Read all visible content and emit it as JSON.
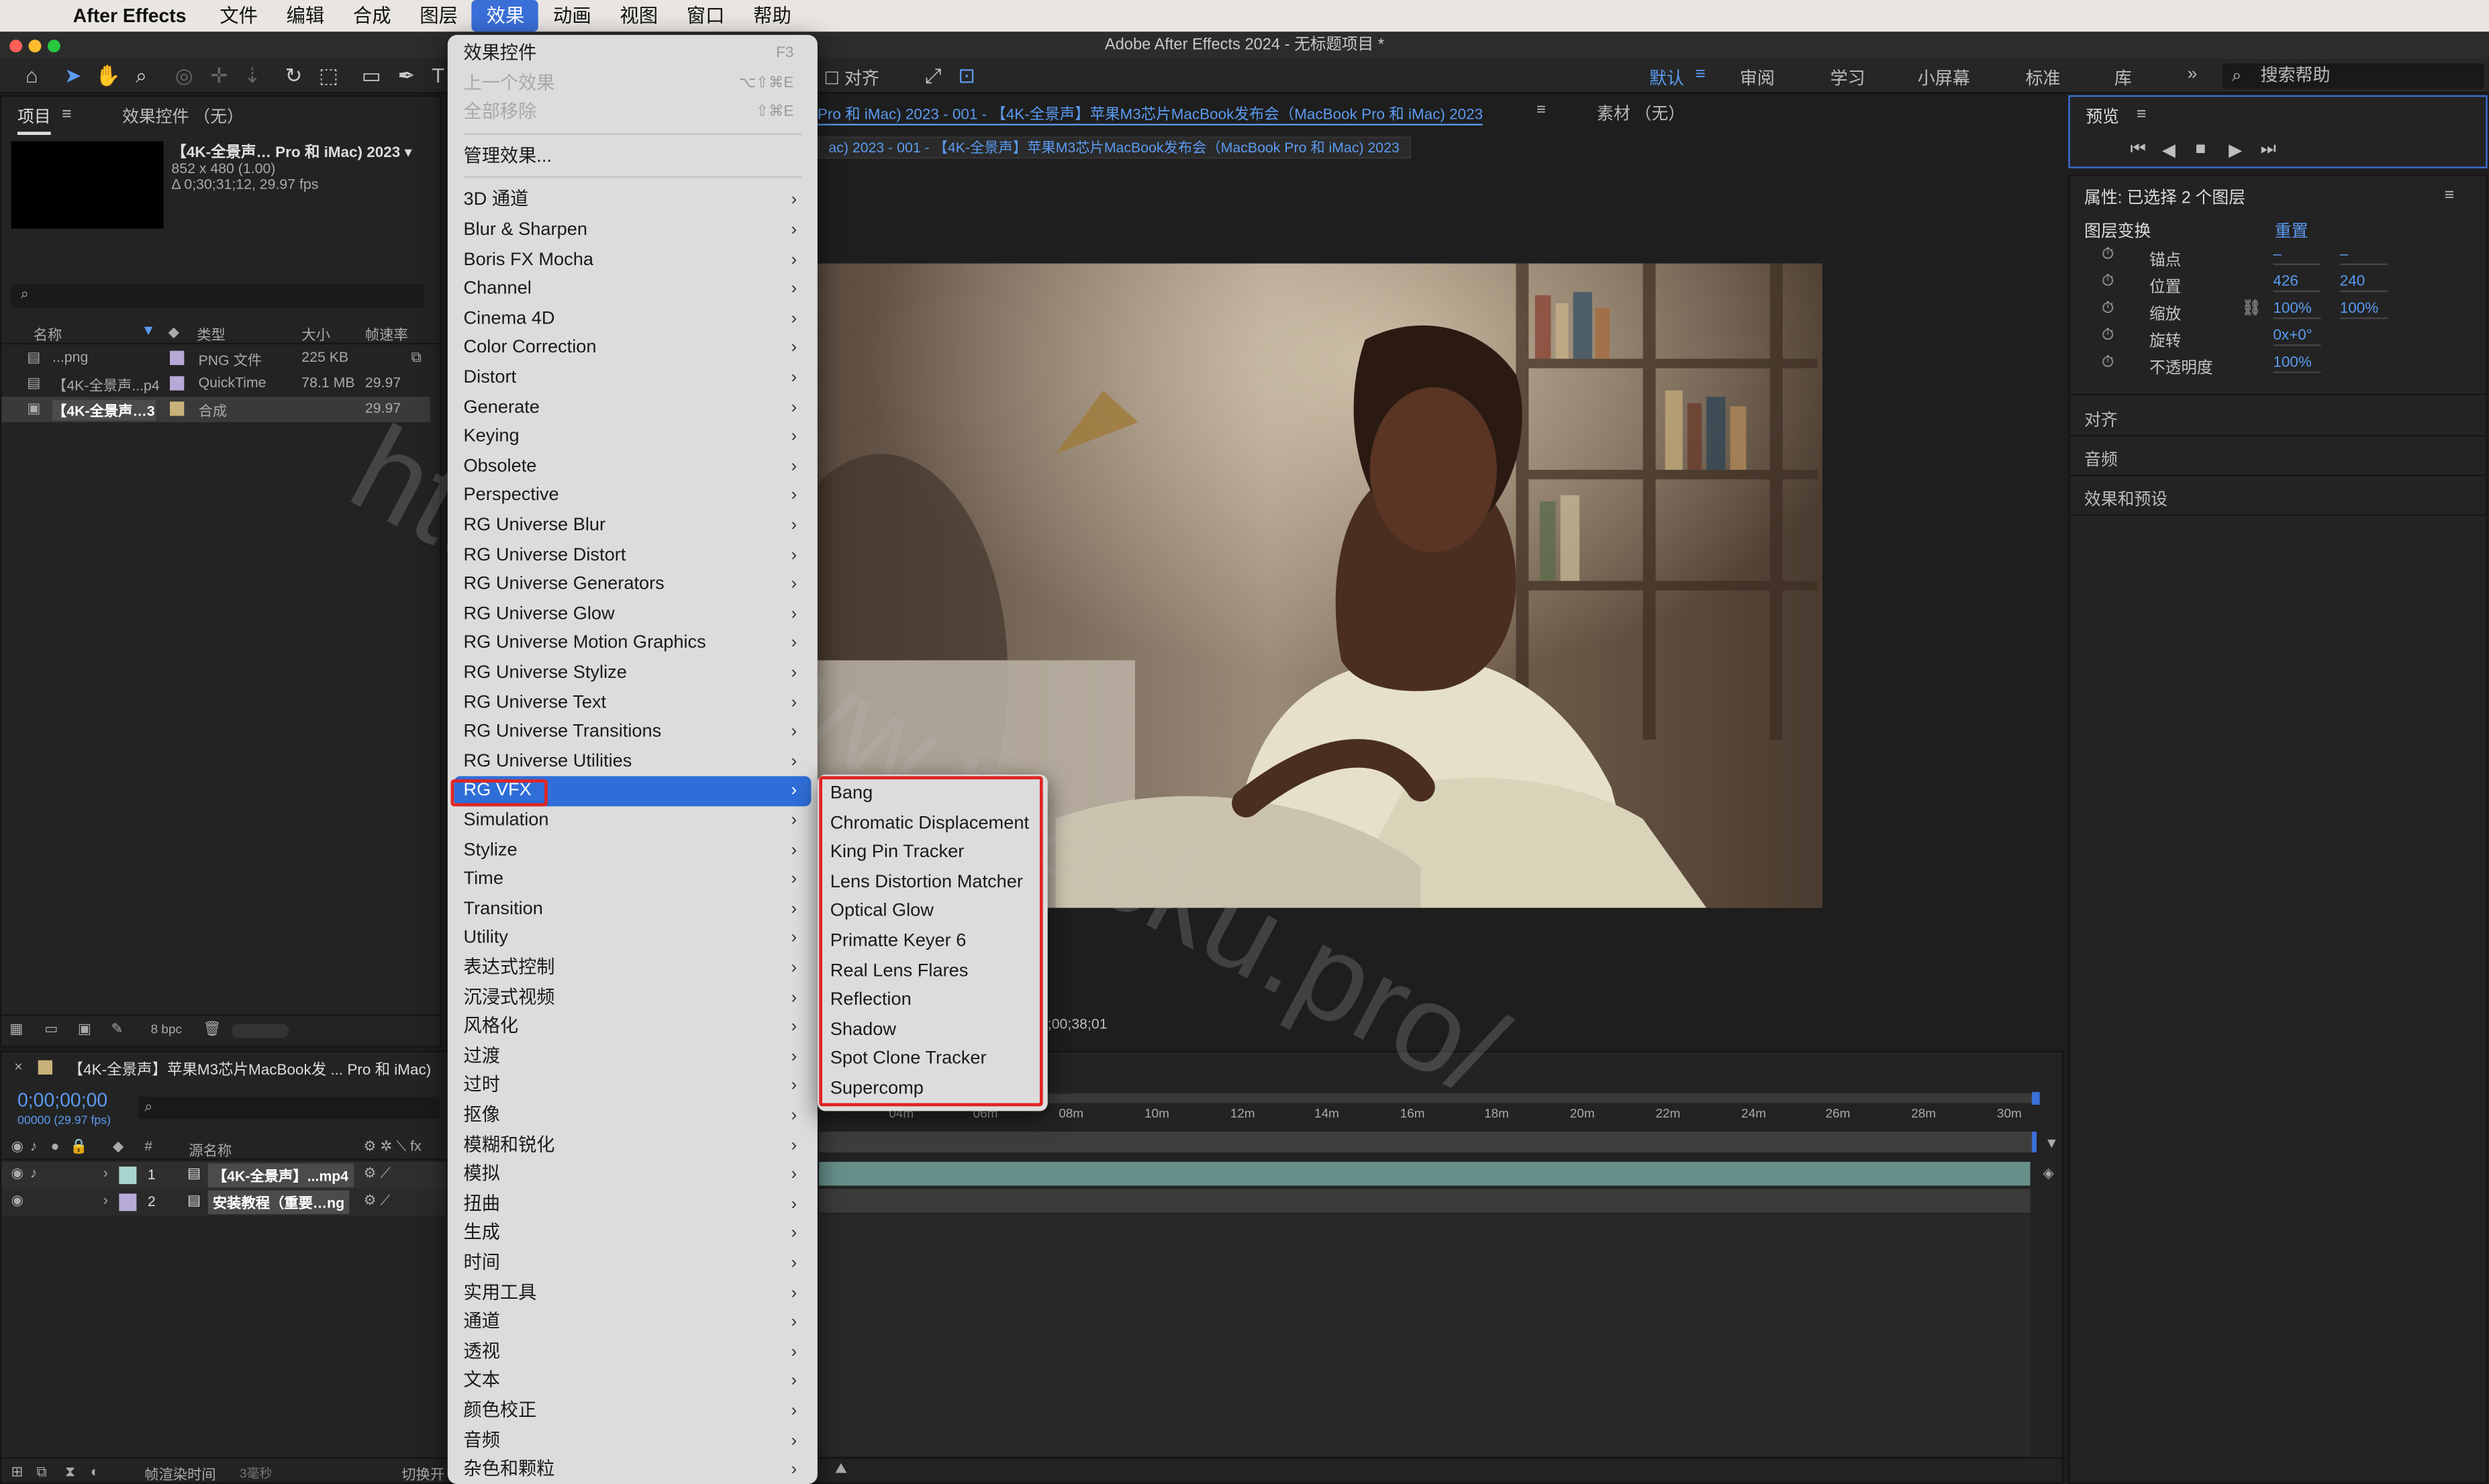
{
  "menubar": {
    "app": "After Effects",
    "items": [
      "文件",
      "编辑",
      "合成",
      "图层",
      "效果",
      "动画",
      "视图",
      "窗口",
      "帮助"
    ],
    "active_index": 4
  },
  "window_title": "Adobe After Effects 2024 - 无标题项目 *",
  "toolbar": {
    "snap_label": "对齐",
    "workspaces": [
      "默认",
      "审阅",
      "学习",
      "小屏幕",
      "标准",
      "库"
    ],
    "active_workspace": "默认",
    "help_search": "搜索帮助"
  },
  "project_panel": {
    "tab_project": "项目",
    "tab_effect_controls": "效果控件 （无）",
    "selected_name": "【4K-全景声… Pro 和 iMac) 2023 ▾",
    "selected_meta1": "852 x 480 (1.00)",
    "selected_meta2": "Δ 0;30;31;12, 29.97 fps",
    "columns": [
      "名称",
      "类型",
      "大小",
      "帧速率"
    ],
    "rows": [
      {
        "name": "...png",
        "type": "PNG 文件",
        "size": "225 KB",
        "fps": ""
      },
      {
        "name": "【4K-全景声...p4",
        "type": "QuickTime",
        "size": "78.1 MB",
        "fps": "29.97"
      },
      {
        "name": "【4K-全景声…3",
        "type": "合成",
        "size": "",
        "fps": "29.97"
      }
    ],
    "bpc": "8 bpc"
  },
  "comp_panel": {
    "tab_label": "Pro 和 iMac) 2023 - 001 - 【4K-全景声】苹果M3芯片MacBook发布会（MacBook Pro 和 iMac) 2023",
    "footage_label": "素材 （无）",
    "breadcrumb": "ac) 2023 - 001 - 【4K-全景声】苹果M3芯片MacBook发布会（MacBook Pro 和 iMac) 2023",
    "timecode": "0;00;38;01"
  },
  "preview_panel": {
    "title": "预览"
  },
  "properties_panel": {
    "title": "属性: 已选择 2 个图层",
    "section": "图层变换",
    "reset": "重置",
    "props": [
      {
        "label": "锚点",
        "v1": "–",
        "v2": "–"
      },
      {
        "label": "位置",
        "v1": "426",
        "v2": "240"
      },
      {
        "label": "缩放",
        "v1": "100%",
        "v2": "100%"
      },
      {
        "label": "旋转",
        "v1": "0x+0°",
        "v2": ""
      },
      {
        "label": "不透明度",
        "v1": "100%",
        "v2": ""
      }
    ],
    "sections": [
      "对齐",
      "音频",
      "效果和预设"
    ]
  },
  "timeline": {
    "comp_tab": "【4K-全景声】苹果M3芯片MacBook发 ... Pro 和 iMac)",
    "current_time": "0;00;00;00",
    "frame_info": "00000 (29.97 fps)",
    "column_source": "源名称",
    "layers": [
      {
        "num": "1",
        "name": "【4K-全景声】...mp4"
      },
      {
        "num": "2",
        "name": "安装教程（重要…ng"
      }
    ],
    "ruler": [
      "04m",
      "06m",
      "08m",
      "10m",
      "12m",
      "14m",
      "16m",
      "18m",
      "20m",
      "22m",
      "24m",
      "26m",
      "28m",
      "30m"
    ],
    "footer_render": "帧渲染时间",
    "footer_ms": "3毫秒",
    "footer_switch": "切换开"
  },
  "effect_menu": {
    "top_items": [
      {
        "label": "效果控件",
        "shortcut": "F3",
        "disabled": false
      },
      {
        "label": "上一个效果",
        "shortcut": "⌥⇧⌘E",
        "disabled": true
      },
      {
        "label": "全部移除",
        "shortcut": "⇧⌘E",
        "disabled": true
      },
      {
        "label": "管理效果...",
        "shortcut": "",
        "disabled": false
      }
    ],
    "categories": [
      "3D 通道",
      "Blur & Sharpen",
      "Boris FX Mocha",
      "Channel",
      "Cinema 4D",
      "Color Correction",
      "Distort",
      "Generate",
      "Keying",
      "Obsolete",
      "Perspective",
      "RG Universe Blur",
      "RG Universe Distort",
      "RG Universe Generators",
      "RG Universe Glow",
      "RG Universe Motion Graphics",
      "RG Universe Stylize",
      "RG Universe Text",
      "RG Universe Transitions",
      "RG Universe Utilities",
      "RG VFX",
      "Simulation",
      "Stylize",
      "Time",
      "Transition",
      "Utility",
      "表达式控制",
      "沉浸式视频",
      "风格化",
      "过渡",
      "过时",
      "抠像",
      "模糊和锐化",
      "模拟",
      "扭曲",
      "生成",
      "时间",
      "实用工具",
      "通道",
      "透视",
      "文本",
      "颜色校正",
      "音频",
      "杂色和颗粒"
    ],
    "selected": "RG VFX"
  },
  "rg_vfx_submenu": [
    "Bang",
    "Chromatic Displacement",
    "King Pin Tracker",
    "Lens Distortion Matcher",
    "Optical Glow",
    "Primatte Keyer 6",
    "Real Lens Flares",
    "Reflection",
    "Shadow",
    "Spot Clone Tracker",
    "Supercomp"
  ],
  "watermark": "https://www.macku.pro/"
}
